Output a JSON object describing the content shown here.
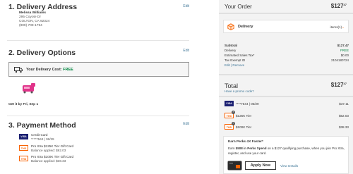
{
  "delivery_address": {
    "title": "1. Delivery Address",
    "edit": "Edit",
    "name": "Melissa Williams",
    "street": "295 Coyote Dr",
    "city": "COLTON, CA 92324",
    "phone": "(909) 709-1794"
  },
  "delivery_options": {
    "title": "2. Delivery Options",
    "edit": "Edit",
    "cost_label": "Your Delivery Cost:",
    "cost_value": "FREE",
    "get_it": "Get it by Fri, Sep 1"
  },
  "payment": {
    "title": "3. Payment Method",
    "edit": "Edit",
    "methods": [
      {
        "badge": "VISA",
        "line1": "Credit Card",
        "line2": "****7544  |  06/29"
      },
      {
        "badge": "THD",
        "line1": "Pro Xtra $125K Tier Gift Card",
        "line2": "Balance applied: $62.03"
      },
      {
        "badge": "THD",
        "line1": "Pro Xtra $100K Tier Gift Card",
        "line2": "Balance applied: $38.33"
      }
    ]
  },
  "order": {
    "title": "Your Order",
    "total_main": "$127",
    "total_cents": "47",
    "delivery_label": "Delivery",
    "items_label": "items(1)",
    "summary": [
      {
        "label": "Subtotal",
        "value": "$127.47"
      },
      {
        "label": "Delivery",
        "value": "FREE"
      },
      {
        "label": "Estimated Sales Tax*",
        "value": "$0.00"
      },
      {
        "label": "Tax Exempt ID",
        "value": "2104180724"
      }
    ],
    "edit_remove": "Edit | Remove",
    "total_label": "Total",
    "promo": "Have a promo code?",
    "payments": [
      {
        "badge": "VISA",
        "label": "****7544  |  06/29",
        "value": "$37.11"
      },
      {
        "badge": "THD",
        "label": "$125K Tier",
        "value": "$62.03"
      },
      {
        "badge": "THD",
        "label": "$100K Tier",
        "value": "$38.33"
      }
    ]
  },
  "perks": {
    "title": "Earn Perks 4X Faster*",
    "desc_pre": "Earn ",
    "desc_bold": "$508 in Perks Spend",
    "desc_post": " on a $127 qualifying purchase, when you join Pro Xtra, register, and use your card.",
    "apply": "Apply Now",
    "details": "View Details"
  },
  "colors": {
    "brand_orange": "#f96302",
    "link_blue": "#3e7697",
    "free_green": "#00853f"
  }
}
